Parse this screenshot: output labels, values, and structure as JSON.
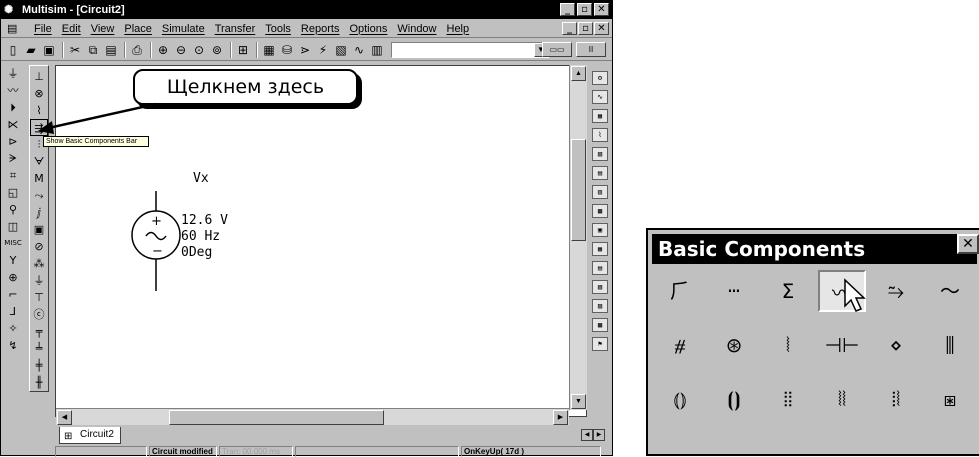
{
  "window": {
    "title": "Multisim - [Circuit2]",
    "controls": [
      "_",
      "▫",
      "✕"
    ]
  },
  "menu": [
    "File",
    "Edit",
    "View",
    "Place",
    "Simulate",
    "Transfer",
    "Tools",
    "Reports",
    "Options",
    "Window",
    "Help"
  ],
  "toolbar": {
    "help": "?"
  },
  "callout": "Щелкнем здесь",
  "tooltip": "Show Basic Components Bar",
  "schematic": {
    "ref": "Vx",
    "voltage": "12.6 V",
    "frequency": "60 Hz",
    "phase": "0Deg"
  },
  "tabs": {
    "active": "Circuit2"
  },
  "status": {
    "modified": "Circuit modified",
    "tran": "Tran: 00.000 ms",
    "key": "OnKeyUp( 17d )"
  },
  "palette": {
    "title": "Basic Components",
    "close": "✕"
  }
}
